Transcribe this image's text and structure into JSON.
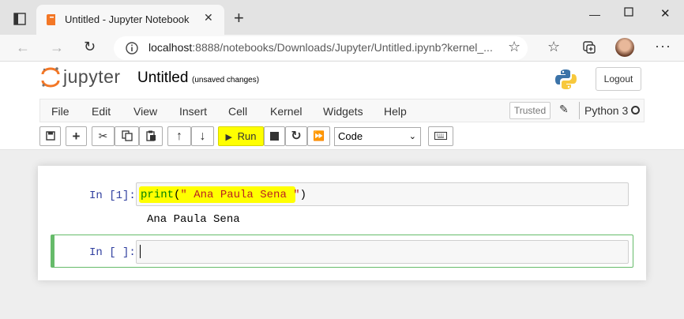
{
  "browser": {
    "tab_title": "Untitled - Jupyter Notebook",
    "new_tab": "+",
    "url_host": "localhost",
    "url_rest": ":8888/notebooks/Downloads/Jupyter/Untitled.ipynb?kernel_...",
    "window_controls": [
      "minimize",
      "maximize",
      "close"
    ]
  },
  "jupyter": {
    "logo_text": "jupyter",
    "notebook_title": "Untitled",
    "save_status": "(unsaved changes)",
    "logout_label": "Logout",
    "menu": [
      "File",
      "Edit",
      "View",
      "Insert",
      "Cell",
      "Kernel",
      "Widgets",
      "Help"
    ],
    "trusted_label": "Trusted",
    "kernel_name": "Python 3",
    "run_label": "Run",
    "cell_type": "Code"
  },
  "cells": [
    {
      "prompt": "In [1]:",
      "code_fn": "print",
      "code_open": "(",
      "code_string": "\" Ana Paula Sena \"",
      "code_close": ")",
      "output": "Ana Paula Sena"
    },
    {
      "prompt": "In [ ]:",
      "code": ""
    }
  ],
  "colors": {
    "highlight": "#ffff00",
    "prompt_blue": "#303f9f",
    "active_cell_green": "#66bb6a",
    "jupyter_orange": "#f37726"
  }
}
